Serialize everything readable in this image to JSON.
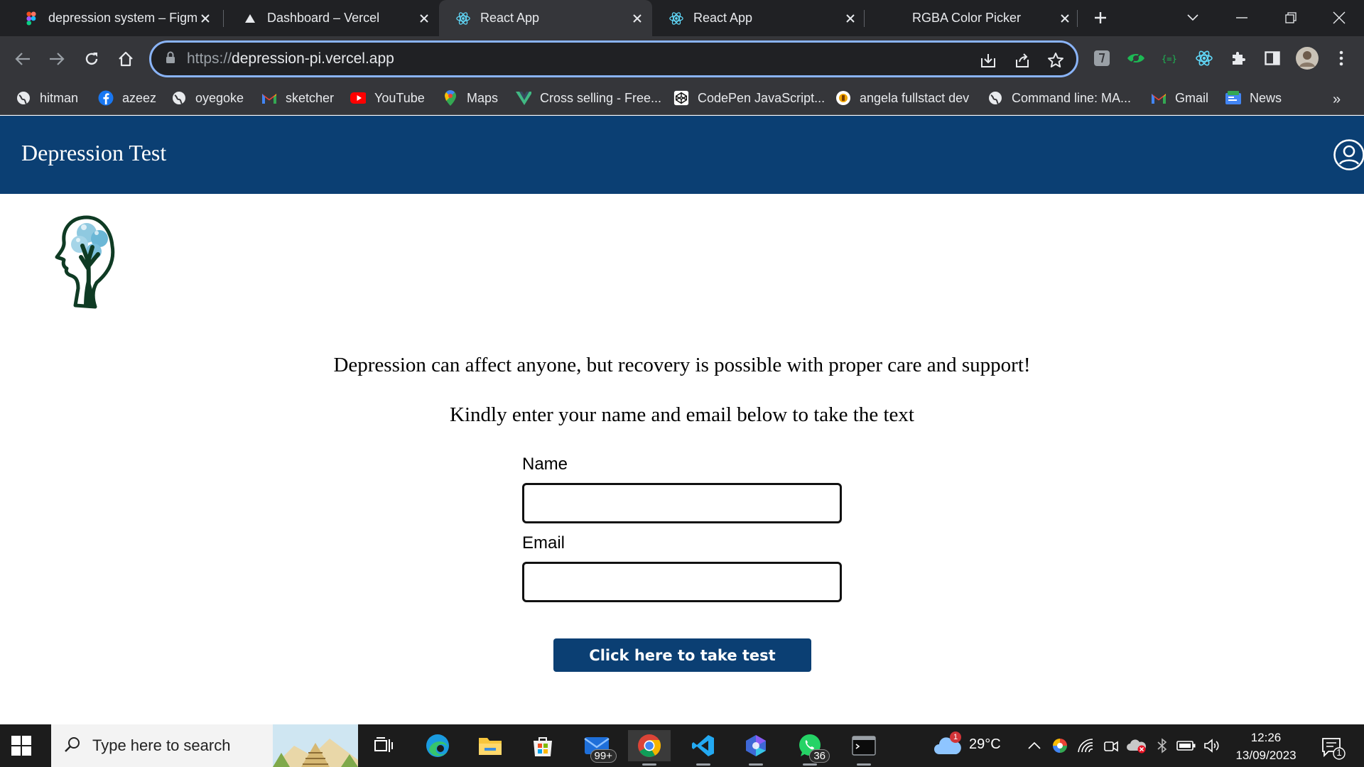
{
  "browser": {
    "tabs": [
      {
        "title": "depression system – Figma",
        "icon": "figma-icon"
      },
      {
        "title": "Dashboard – Vercel",
        "icon": "vercel-icon"
      },
      {
        "title": "React App",
        "icon": "react-icon"
      },
      {
        "title": "React App",
        "icon": "react-icon"
      },
      {
        "title": "RGBA Color Picker",
        "icon": "none"
      }
    ],
    "active_tab": 2,
    "url_scheme": "https://",
    "url_host": "depression-pi.vercel.app",
    "bookmarks": [
      {
        "label": "hitman",
        "icon": "globe-icon"
      },
      {
        "label": "azeez",
        "icon": "facebook-icon"
      },
      {
        "label": "oyegoke",
        "icon": "globe-icon"
      },
      {
        "label": "sketcher",
        "icon": "gmail-icon"
      },
      {
        "label": "YouTube",
        "icon": "youtube-icon"
      },
      {
        "label": "Maps",
        "icon": "maps-icon"
      },
      {
        "label": "Cross selling - Free...",
        "icon": "vue-icon"
      },
      {
        "label": "CodePen JavaScript...",
        "icon": "codepen-icon"
      },
      {
        "label": "angela fullstact dev",
        "icon": "udemy-icon"
      },
      {
        "label": "Command line: MA...",
        "icon": "globe-icon"
      },
      {
        "label": "Gmail",
        "icon": "gmail-icon"
      },
      {
        "label": "News",
        "icon": "news-icon"
      }
    ],
    "more_bookmarks": "»"
  },
  "app": {
    "title": "Depression Test",
    "intro": "Depression can affect anyone, but recovery is possible with proper care and support!",
    "instruction": "Kindly enter your name and email below to take the text",
    "form": {
      "name_label": "Name",
      "name_value": "",
      "email_label": "Email",
      "email_value": ""
    },
    "cta_label": "Click here to take test"
  },
  "colors": {
    "brand": "#0b3f73",
    "omnibox_focus": "#8ab4f8",
    "logo_green": "#0f3b24"
  },
  "taskbar": {
    "search_placeholder": "Type here to search",
    "mail_badge": "99+",
    "whatsapp_badge": "36",
    "weather_badge": "1",
    "temperature": "29°C",
    "time": "12:26",
    "date": "13/09/2023",
    "notification_count": "1"
  }
}
